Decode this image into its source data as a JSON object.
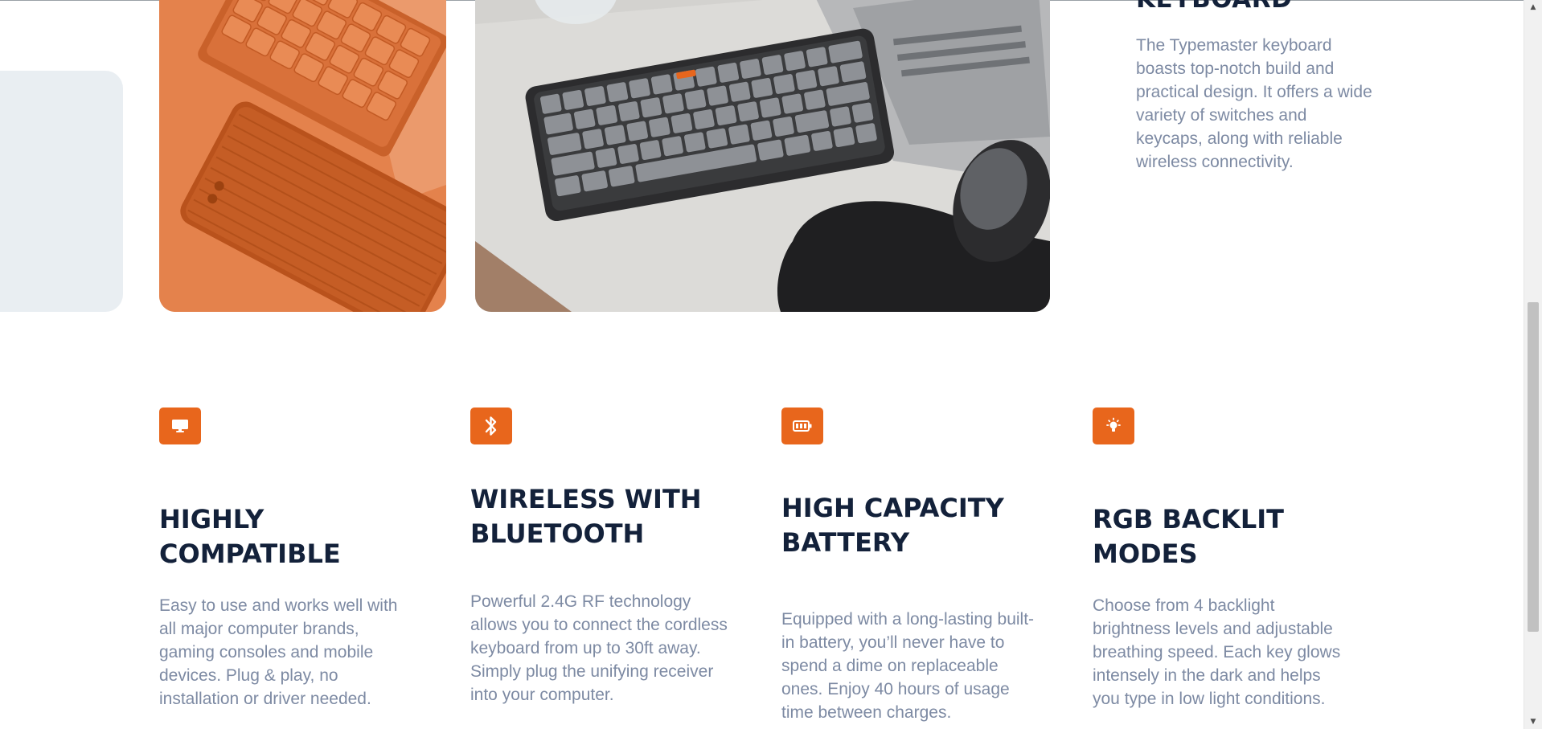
{
  "side": {
    "title": "KEYBOARD",
    "description": "The Typemaster keyboard boasts top-notch build and practical design. It offers a wide variety of switches and keycaps, along with reliable wireless connectivity."
  },
  "features": [
    {
      "icon": "monitor-icon",
      "title": "HIGHLY COMPATIBLE",
      "description": "Easy to use and works well with all major computer brands, gaming consoles and mobile devices. Plug & play, no installation or driver needed."
    },
    {
      "icon": "bluetooth-icon",
      "title": "WIRELESS WITH BLUETOOTH",
      "description": "Powerful 2.4G RF technology allows you to connect the cordless keyboard from up to 30ft away. Simply plug the unifying receiver into your computer."
    },
    {
      "icon": "battery-icon",
      "title": "HIGH CAPACITY BATTERY",
      "description": "Equipped with a long-lasting built-in battery, you’ll never have to spend a dime on replaceable ones.  Enjoy 40 hours of usage time between charges."
    },
    {
      "icon": "lightbulb-icon",
      "title": "RGB BACKLIT MODES",
      "description": "Choose from 4 backlight brightness levels and adjustable breathing speed. Each key glows intensely in the dark and helps you type in low light conditions."
    }
  ],
  "colors": {
    "accent": "#e8661c",
    "heading": "#13213a",
    "body_text": "#7d8aa3",
    "card_gray": "#e9eef2"
  }
}
